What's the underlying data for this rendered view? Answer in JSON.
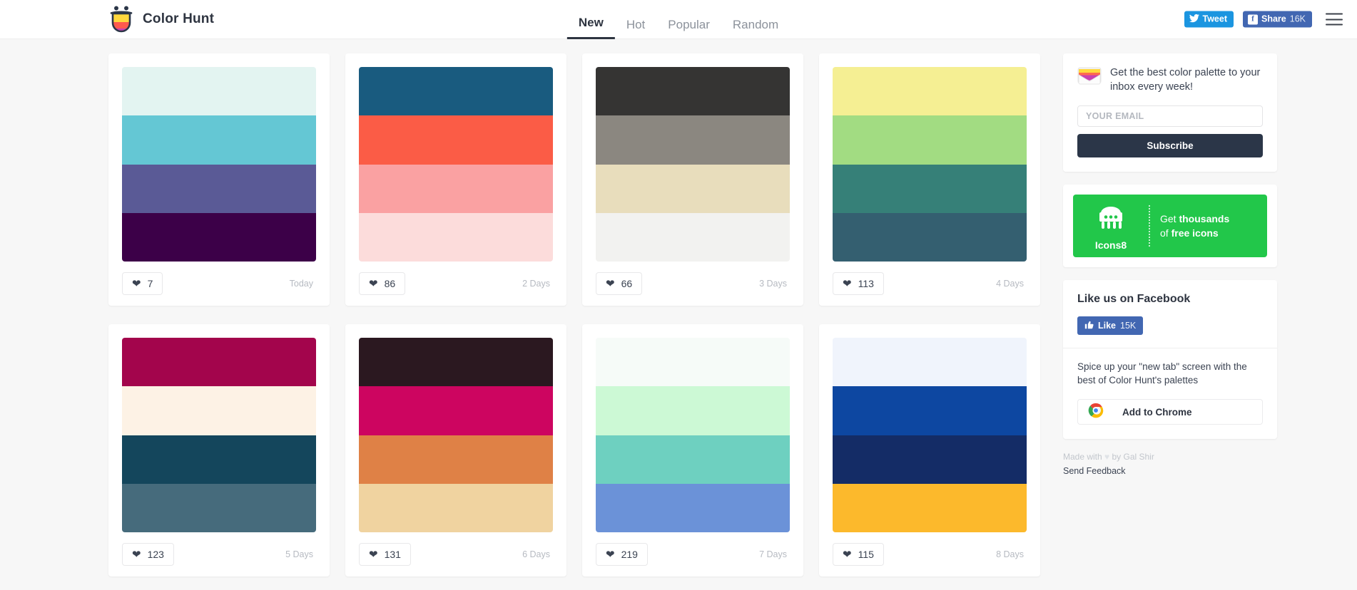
{
  "header": {
    "brand": "Color Hunt",
    "logo_icon": "color-hunt-logo",
    "nav": [
      {
        "label": "New",
        "active": true
      },
      {
        "label": "Hot",
        "active": false
      },
      {
        "label": "Popular",
        "active": false
      },
      {
        "label": "Random",
        "active": false
      }
    ],
    "tweet": {
      "label": "Tweet",
      "icon": "twitter-bird-icon",
      "color": "#1b95e0"
    },
    "share": {
      "label": "Share",
      "count": "16K",
      "icon": "facebook-icon",
      "color": "#4267b2"
    },
    "menu_icon": "hamburger-menu-icon"
  },
  "palettes": [
    {
      "colors": [
        "#e3f4f1",
        "#64c7d4",
        "#5a5a96",
        "#3c0048"
      ],
      "likes": "7",
      "age": "Today"
    },
    {
      "colors": [
        "#195b7f",
        "#fb5c46",
        "#faa1a2",
        "#fcdcdb"
      ],
      "likes": "86",
      "age": "2 Days"
    },
    {
      "colors": [
        "#353433",
        "#8b8780",
        "#e8ddbc",
        "#f2f2f0"
      ],
      "likes": "66",
      "age": "3 Days"
    },
    {
      "colors": [
        "#f5ef93",
        "#a2dc82",
        "#368078",
        "#345f70"
      ],
      "likes": "113",
      "age": "4 Days"
    },
    {
      "colors": [
        "#a3054c",
        "#fdf2e5",
        "#14465c",
        "#466b7c"
      ],
      "likes": "123",
      "age": "5 Days"
    },
    {
      "colors": [
        "#2b1820",
        "#cd0560",
        "#df8146",
        "#f0d3a0"
      ],
      "likes": "131",
      "age": "6 Days"
    },
    {
      "colors": [
        "#f6fbf8",
        "#ccf9d5",
        "#6ed0c0",
        "#6b92d8"
      ],
      "likes": "219",
      "age": "7 Days"
    },
    {
      "colors": [
        "#f0f4fc",
        "#0d47a1",
        "#142c66",
        "#fcb92c"
      ],
      "likes": "115",
      "age": "8 Days"
    }
  ],
  "sidebar": {
    "subscribe": {
      "icon": "envelope-icon",
      "headline": "Get the best color palette to your inbox every week!",
      "email_placeholder": "YOUR EMAIL",
      "email_value": "",
      "button": "Subscribe"
    },
    "ad": {
      "brand": "Icons8",
      "icon": "icons8-robot-icon",
      "line1_plain": "Get ",
      "line1_bold": "thousands",
      "line2_plain": "of ",
      "line2_bold": "free icons",
      "color": "#22c74a"
    },
    "facebook": {
      "title": "Like us on Facebook",
      "like_label": "Like",
      "like_count": "15K",
      "icon": "thumbs-up-icon"
    },
    "chrome": {
      "text": "Spice up your \"new tab\" screen with the best of Color Hunt's palettes",
      "button": "Add to Chrome",
      "icon": "chrome-icon"
    },
    "footer": {
      "made_with_pre": "Made with ",
      "heart": "♥",
      "made_with_post": " by Gal Shir",
      "feedback": "Send Feedback"
    }
  }
}
